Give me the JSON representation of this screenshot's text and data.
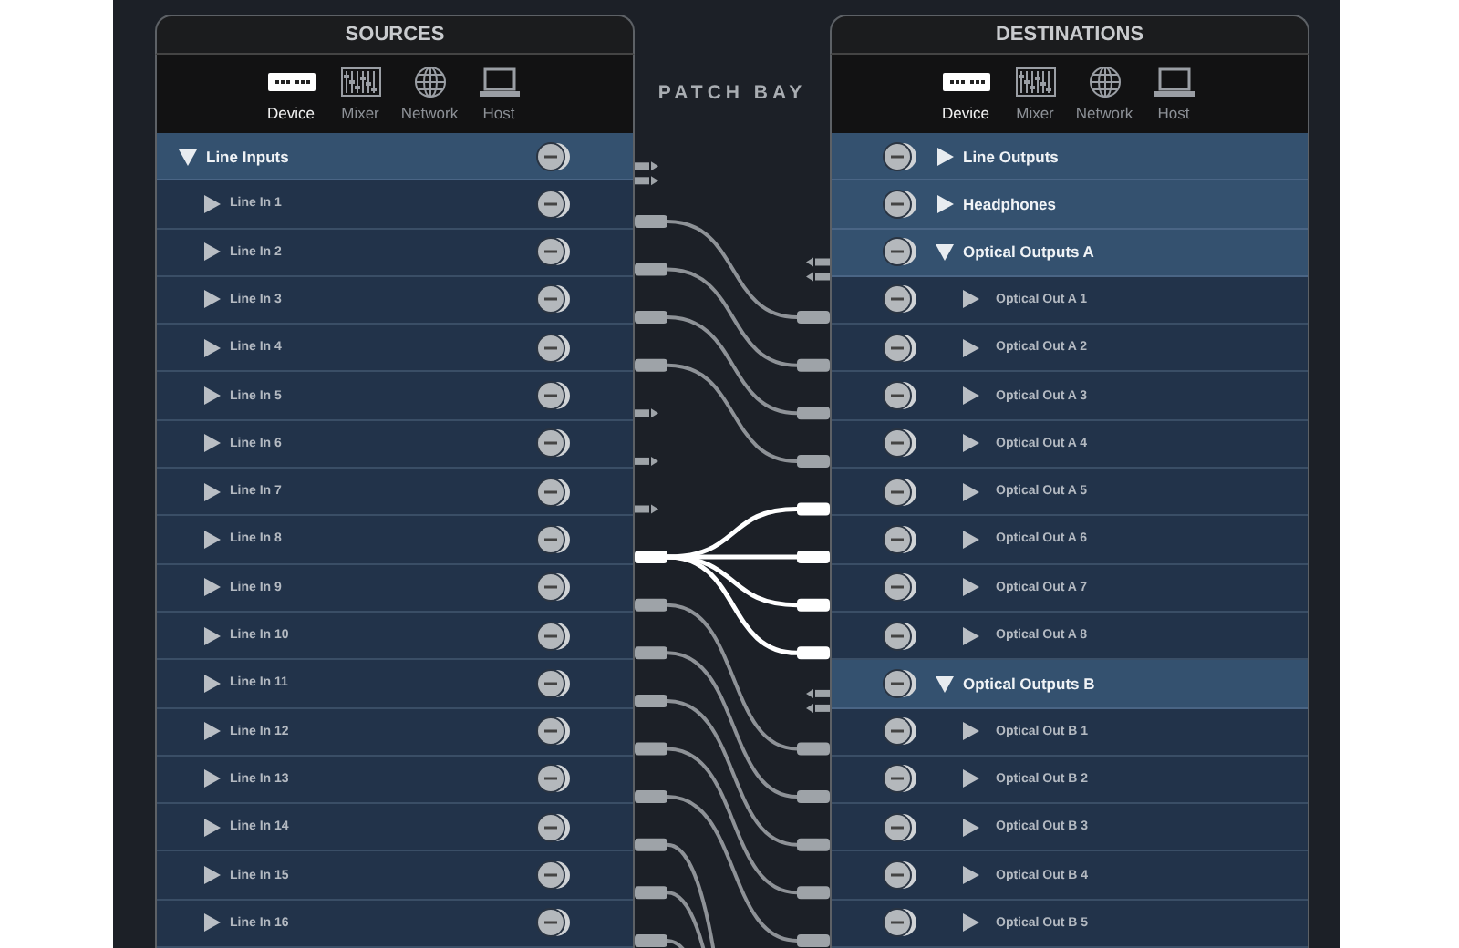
{
  "title": "PATCH BAY",
  "sources": {
    "title": "SOURCES",
    "tabs": [
      {
        "label": "Device",
        "kind": "device",
        "selected": true
      },
      {
        "label": "Mixer",
        "kind": "mixer",
        "selected": false
      },
      {
        "label": "Network",
        "kind": "network",
        "selected": false
      },
      {
        "label": "Host",
        "kind": "host",
        "selected": false
      }
    ],
    "groups": [
      {
        "label": "Line Inputs",
        "expanded": true,
        "children": [
          {
            "label": "Line In 1",
            "expanded": false,
            "patched": true,
            "selected": false
          },
          {
            "label": "Line In 2",
            "expanded": false,
            "patched": true,
            "selected": false
          },
          {
            "label": "Line In 3",
            "expanded": false,
            "patched": true,
            "selected": false
          },
          {
            "label": "Line In 4",
            "expanded": false,
            "patched": true,
            "selected": false
          },
          {
            "label": "Line In 5",
            "expanded": false,
            "patched": false,
            "selected": false
          },
          {
            "label": "Line In 6",
            "expanded": false,
            "patched": false,
            "selected": false
          },
          {
            "label": "Line In 7",
            "expanded": false,
            "patched": false,
            "selected": false
          },
          {
            "label": "Line In 8",
            "expanded": false,
            "patched": true,
            "selected": true
          },
          {
            "label": "Line In 9",
            "expanded": false,
            "patched": true,
            "selected": false
          },
          {
            "label": "Line In 10",
            "expanded": false,
            "patched": true,
            "selected": false
          },
          {
            "label": "Line In 11",
            "expanded": false,
            "patched": true,
            "selected": false
          },
          {
            "label": "Line In 12",
            "expanded": false,
            "patched": true,
            "selected": false
          },
          {
            "label": "Line In 13",
            "expanded": false,
            "patched": true,
            "selected": false
          },
          {
            "label": "Line In 14",
            "expanded": false,
            "patched": true,
            "selected": false
          },
          {
            "label": "Line In 15",
            "expanded": false,
            "patched": true,
            "selected": false
          },
          {
            "label": "Line In 16",
            "expanded": false,
            "patched": true,
            "selected": false
          }
        ]
      }
    ]
  },
  "destinations": {
    "title": "DESTINATIONS",
    "tabs": [
      {
        "label": "Device",
        "kind": "device",
        "selected": true
      },
      {
        "label": "Mixer",
        "kind": "mixer",
        "selected": false
      },
      {
        "label": "Network",
        "kind": "network",
        "selected": false
      },
      {
        "label": "Host",
        "kind": "host",
        "selected": false
      }
    ],
    "groups": [
      {
        "label": "Line Outputs",
        "expanded": false
      },
      {
        "label": "Headphones",
        "expanded": false
      },
      {
        "label": "Optical Outputs A",
        "expanded": true,
        "children": [
          {
            "label": "Optical Out A 1",
            "expanded": false,
            "patched": true,
            "selected": false
          },
          {
            "label": "Optical Out A 2",
            "expanded": false,
            "patched": true,
            "selected": false
          },
          {
            "label": "Optical Out A 3",
            "expanded": false,
            "patched": true,
            "selected": false
          },
          {
            "label": "Optical Out A 4",
            "expanded": false,
            "patched": true,
            "selected": false
          },
          {
            "label": "Optical Out A 5",
            "expanded": false,
            "patched": true,
            "selected": true
          },
          {
            "label": "Optical Out A 6",
            "expanded": false,
            "patched": true,
            "selected": true
          },
          {
            "label": "Optical Out A 7",
            "expanded": false,
            "patched": true,
            "selected": true
          },
          {
            "label": "Optical Out A 8",
            "expanded": false,
            "patched": true,
            "selected": true
          }
        ]
      },
      {
        "label": "Optical Outputs B",
        "expanded": true,
        "children": [
          {
            "label": "Optical Out B 1",
            "expanded": false,
            "patched": true,
            "selected": false
          },
          {
            "label": "Optical Out B 2",
            "expanded": false,
            "patched": true,
            "selected": false
          },
          {
            "label": "Optical Out B 3",
            "expanded": false,
            "patched": true,
            "selected": false
          },
          {
            "label": "Optical Out B 4",
            "expanded": false,
            "patched": true,
            "selected": false
          },
          {
            "label": "Optical Out B 5",
            "expanded": false,
            "patched": true,
            "selected": false
          }
        ]
      }
    ]
  }
}
